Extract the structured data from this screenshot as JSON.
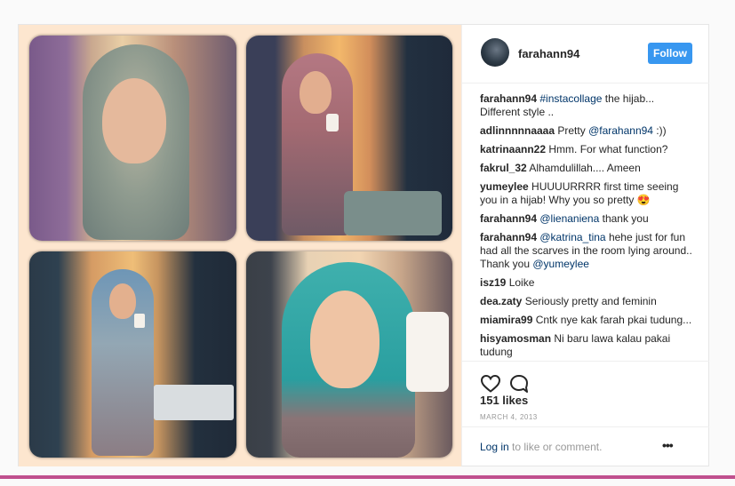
{
  "header": {
    "username": "farahann94",
    "follow_label": "Follow"
  },
  "comments": [
    {
      "user": "farahann94",
      "parts": [
        {
          "t": "tag",
          "v": "#instacollage"
        },
        {
          "t": "text",
          "v": " the hijab... Different style .."
        }
      ]
    },
    {
      "user": "adlinnnnnaaaa",
      "parts": [
        {
          "t": "text",
          "v": "Pretty "
        },
        {
          "t": "tag",
          "v": "@farahann94"
        },
        {
          "t": "text",
          "v": " :))"
        }
      ]
    },
    {
      "user": "katrinaann22",
      "parts": [
        {
          "t": "text",
          "v": "Hmm. For what function?"
        }
      ]
    },
    {
      "user": "fakrul_32",
      "parts": [
        {
          "t": "text",
          "v": "Alhamdulillah.... Ameen"
        }
      ]
    },
    {
      "user": "yumeylee",
      "parts": [
        {
          "t": "text",
          "v": "HUUUURRRR first time seeing you in a hijab! Why you so pretty 😍"
        }
      ]
    },
    {
      "user": "farahann94",
      "parts": [
        {
          "t": "tag",
          "v": "@lienaniena"
        },
        {
          "t": "text",
          "v": " thank you"
        }
      ]
    },
    {
      "user": "farahann94",
      "parts": [
        {
          "t": "tag",
          "v": "@katrina_tina"
        },
        {
          "t": "text",
          "v": " hehe just for fun had all the scarves in the room lying around.. Thank you "
        },
        {
          "t": "tag",
          "v": "@yumeylee"
        }
      ]
    },
    {
      "user": "isz19",
      "parts": [
        {
          "t": "text",
          "v": "Loike"
        }
      ]
    },
    {
      "user": "dea.zaty",
      "parts": [
        {
          "t": "text",
          "v": "Seriously pretty and feminin"
        }
      ]
    },
    {
      "user": "miamira99",
      "parts": [
        {
          "t": "text",
          "v": "Cntk nye kak farah pkai tudung..."
        }
      ]
    },
    {
      "user": "hisyamosman",
      "parts": [
        {
          "t": "text",
          "v": "Ni baru lawa kalau pakai tudung"
        }
      ]
    }
  ],
  "actions": {
    "like_icon": "heart-icon",
    "comment_icon": "comment-bubble-icon"
  },
  "likes_text": "151 likes",
  "date_text": "MARCH 4, 2013",
  "login": {
    "link_label": "Log in",
    "rest_text": " to like or comment."
  },
  "more_label": "•••",
  "colors": {
    "accent": "#3897f0",
    "link": "#003569",
    "bottom_bar": "#c0508e"
  }
}
